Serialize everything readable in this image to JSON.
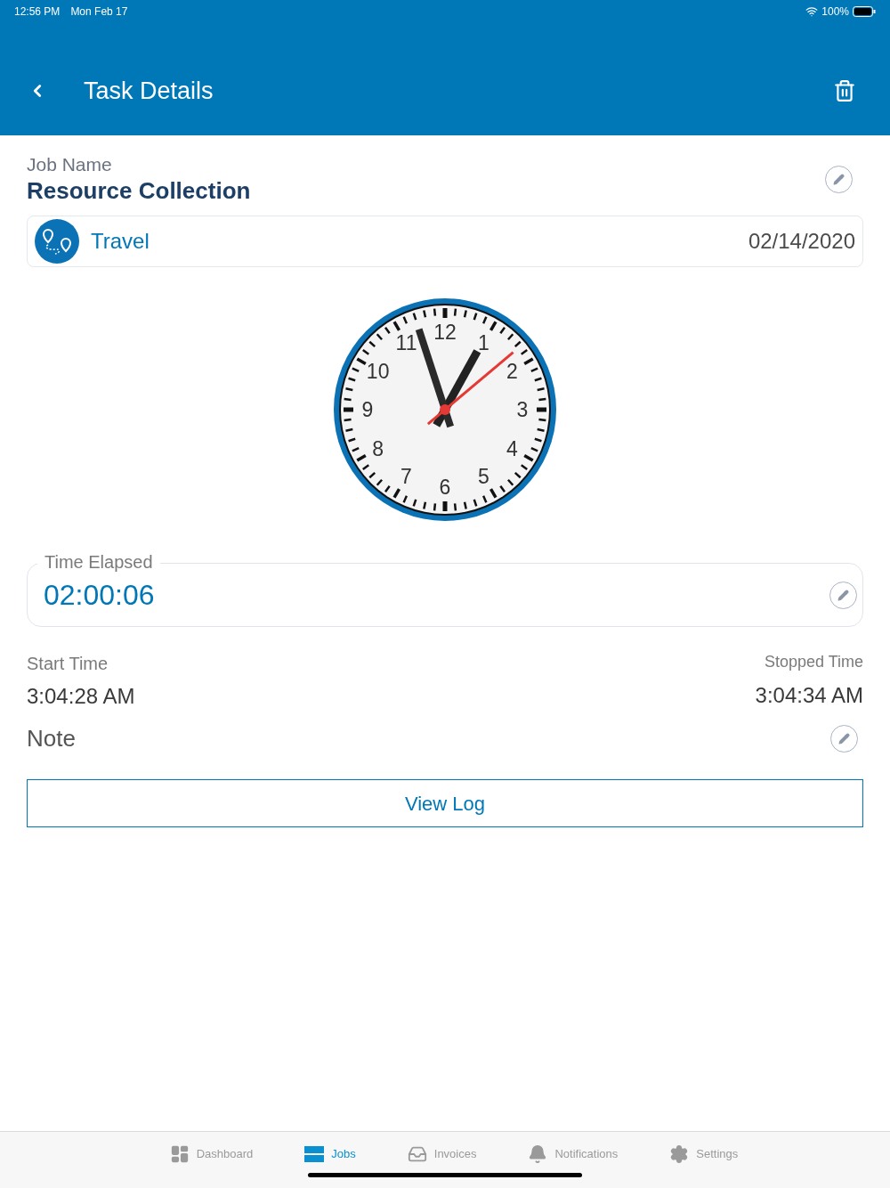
{
  "status_bar": {
    "time": "12:56 PM",
    "date": "Mon Feb 17",
    "battery": "100%"
  },
  "header": {
    "title": "Task Details"
  },
  "job": {
    "label": "Job Name",
    "name": "Resource Collection"
  },
  "task": {
    "type": "Travel",
    "date": "02/14/2020"
  },
  "clock": {
    "dial_numbers": [
      "12",
      "1",
      "2",
      "3",
      "4",
      "5",
      "6",
      "7",
      "8",
      "9",
      "10",
      "11"
    ]
  },
  "time_elapsed": {
    "label": "Time Elapsed",
    "value": "02:00:06"
  },
  "start": {
    "label": "Start Time",
    "value": "3:04:28 AM"
  },
  "stopped": {
    "label": "Stopped Time",
    "value": "3:04:34 AM"
  },
  "note": {
    "label": "Note"
  },
  "view_log": "View Log",
  "tabs": [
    {
      "label": "Dashboard",
      "kind": "dashboard",
      "selected": false
    },
    {
      "label": "Jobs",
      "kind": "jobs",
      "selected": true
    },
    {
      "label": "Invoices",
      "kind": "invoices",
      "selected": false
    },
    {
      "label": "Notifications",
      "kind": "notifications",
      "selected": false
    },
    {
      "label": "Settings",
      "kind": "settings",
      "selected": false
    }
  ]
}
